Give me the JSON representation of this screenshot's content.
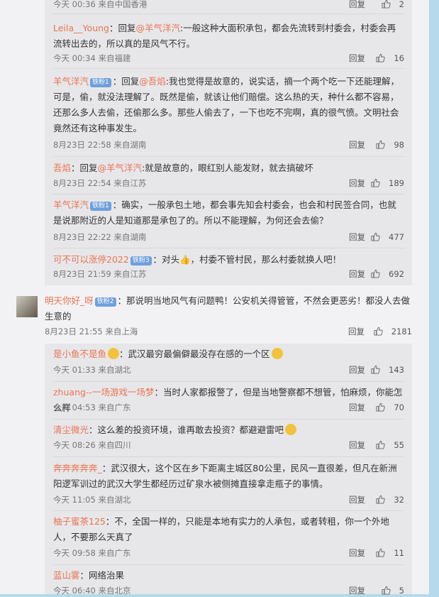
{
  "comments_top": [
    {
      "meta": {
        "time": "今天 00:36 来自中国香港",
        "reply": "回复",
        "likes": "2"
      }
    },
    {
      "user": "Leila__Young",
      "badge": "",
      "prefix": "：回复",
      "at": "@羊气洋汽",
      "text": ":一般这种大面积承包，都会先流转到村委会，村委会再流转出去的，所以真的是风气不行。",
      "meta": {
        "time": "今天 00:34 来自福建",
        "reply": "回复",
        "likes": "16"
      }
    },
    {
      "user": "羊气洋汽",
      "badge": "铁粉1",
      "prefix": "：回复",
      "at": "@吾焰",
      "text": ":我也觉得是故意的，说实话，摘一个两个吃一下还能理解，可是，偷，就没法理解了。既然是偷，就该让他们赔偿。这么热的天，种什么都不容易，还那么多人去偷，还偷那么多。那些人偷去了，一下也吃不完啊，真的很气愤。文明社会竟然还有这种事发生。",
      "meta": {
        "time": "8月23日 22:58 来自湖南",
        "reply": "回复",
        "likes": "98"
      }
    },
    {
      "user": "吾焰",
      "badge": "",
      "prefix": "：回复",
      "at": "@羊气洋汽",
      "text": ":就是故意的，眼红别人能发财，就去搞破坏",
      "meta": {
        "time": "8月23日 22:54 来自江苏",
        "reply": "回复",
        "likes": "189"
      }
    },
    {
      "user": "羊气洋汽",
      "badge": "铁粉1",
      "prefix": "：",
      "at": "",
      "text": "确实，一般承包土地，都会事先知会村委会，也会和村民签合同，也就是说那附近的人是知道那是承包了的。所以不能理解，为何还会去偷？",
      "meta": {
        "time": "8月23日 22:22 来自湖南",
        "reply": "回复",
        "likes": "477"
      }
    },
    {
      "user": "可不可以涨停2022",
      "badge": "铁粉3",
      "prefix": "：",
      "at": "",
      "text": "对头👍，村委不管村民，那么村委就换人吧！",
      "meta": {
        "time": "8月23日 21:59 来自江苏",
        "reply": "回复",
        "likes": "692"
      }
    }
  ],
  "main_comment": {
    "user": "明天你好_呀",
    "badge": "铁粉2",
    "text": "：那说明当地风气有问题鸭！公安机关得管管，不然会更恶劣！都没人去做生意的",
    "meta": {
      "time": "8月23日 21:55 来自上海",
      "reply": "回复",
      "likes": "2181"
    }
  },
  "comments_bottom": [
    {
      "user": "是小鱼不是鱼",
      "text": "：武汉最穷最偏僻最没存在感的一个区",
      "meta": {
        "time": "今天 01:33 来自湖北",
        "reply": "回复",
        "likes": "143"
      }
    },
    {
      "user": "zhuang--一场游戏一场梦",
      "text": "：当时人家都报警了，但是当地警察都不想管，怕麻烦，你能怎么样",
      "meta": {
        "time": "今天 04:53 来自广东",
        "reply": "回复",
        "likes": "70"
      }
    },
    {
      "user": "清尘微光",
      "text": "：这么差的投资环境，谁再敢去投资？都避避雷吧",
      "meta": {
        "time": "今天 08:26 来自四川",
        "reply": "回复",
        "likes": "55"
      }
    },
    {
      "user": "奔奔奔奔奔_",
      "text": "：武汉很大，这个区在乡下距离主城区80公里，民风一直很差，但凡在新洲阳逻军训过的武汉大学生都经历过矿泉水被侧摊直接拿走瓶子的事情。",
      "meta": {
        "time": "今天 11:05 来自湖北",
        "reply": "回复",
        "likes": "32"
      }
    },
    {
      "user": "柚子蜜茶125",
      "text": "：不，全国一样的，只能是本地有实力的人承包，或者转租，你一个外地人，不要那么天真了",
      "meta": {
        "time": "今天 09:58 来自广东",
        "reply": "回复",
        "likes": "11"
      }
    },
    {
      "user": "蓝山雾",
      "text": "：网络治果",
      "meta": {
        "time": "今天 06:40 来自北京",
        "reply": "回复",
        "likes": "5"
      }
    }
  ]
}
